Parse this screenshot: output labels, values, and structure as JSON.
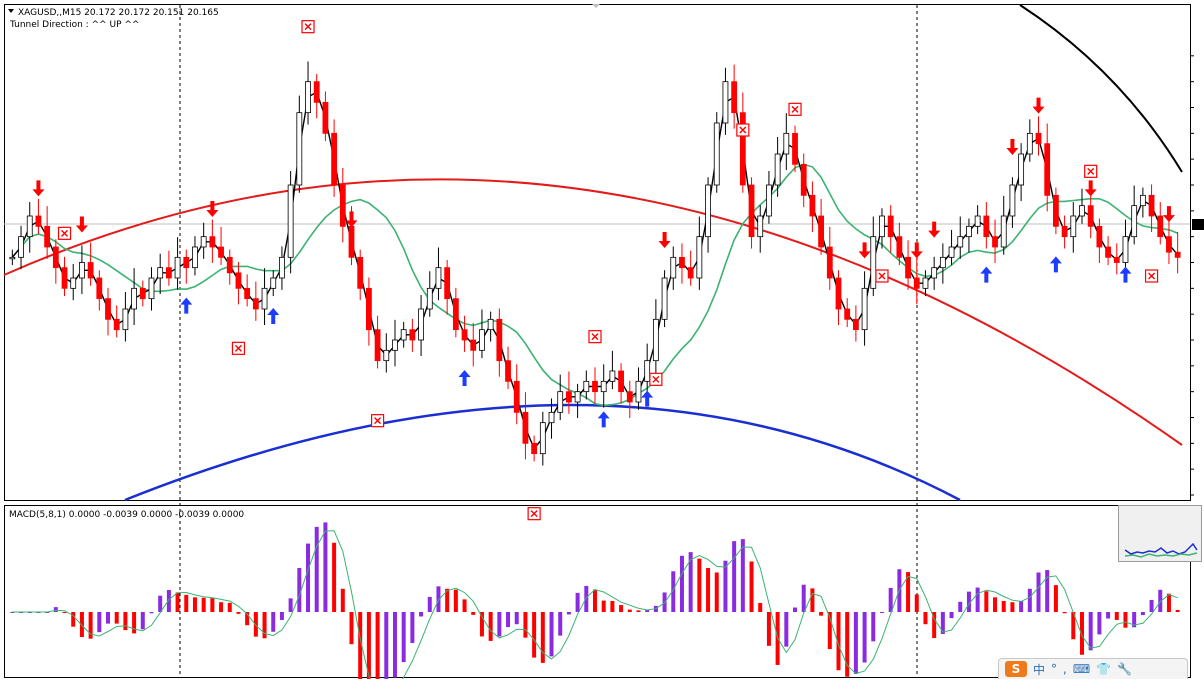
{
  "header": {
    "symbol_line": "XAGUSD,,M15  20.172 20.172 20.151 20.165",
    "tunnel_line": "Tunnel Direction : ^^ UP ^^"
  },
  "macd": {
    "label": "MACD(5,8,1) 0.0000 -0.0039 0.0000 -0.0039 0.0000"
  },
  "colors": {
    "bull": "#ffffff",
    "bear": "#ff0000",
    "ma_fast": "#000000",
    "ma_slow": "#3cb371",
    "arc_red": "#e31b1b",
    "arc_blue": "#1a2fd1",
    "arc_black": "#000000",
    "arrow_up": "#1e3cff",
    "arrow_down": "#ff0000",
    "hist_purple": "#8a2be2",
    "hist_red": "#ff0000"
  },
  "chart_data": {
    "type": "candlestick",
    "series": [
      {
        "name": "XAGUSD,M15",
        "values": [
          20.172,
          20.172,
          20.151,
          20.165
        ]
      }
    ],
    "price_sequence": [
      20.16,
      20.2,
      20.24,
      20.22,
      20.18,
      20.14,
      20.1,
      20.12,
      20.15,
      20.12,
      20.08,
      20.04,
      20.02,
      20.06,
      20.1,
      20.08,
      20.12,
      20.14,
      20.12,
      20.16,
      20.14,
      20.18,
      20.2,
      20.18,
      20.16,
      20.13,
      20.1,
      20.08,
      20.06,
      20.1,
      20.12,
      20.16,
      20.3,
      20.44,
      20.5,
      20.46,
      20.4,
      20.3,
      20.22,
      20.16,
      20.1,
      20.02,
      19.96,
      19.98,
      20.0,
      20.02,
      20.0,
      20.06,
      20.1,
      20.14,
      20.08,
      20.02,
      20.0,
      19.98,
      20.02,
      20.04,
      19.96,
      19.92,
      19.86,
      19.8,
      19.78,
      19.84,
      19.86,
      19.9,
      19.88,
      19.9,
      19.92,
      19.9,
      19.92,
      19.94,
      19.9,
      19.88,
      19.92,
      19.96,
      20.04,
      20.12,
      20.16,
      20.14,
      20.12,
      20.2,
      20.3,
      20.42,
      20.5,
      20.44,
      20.3,
      20.2,
      20.24,
      20.3,
      20.36,
      20.4,
      20.34,
      20.28,
      20.24,
      20.18,
      20.12,
      20.06,
      20.04,
      20.02,
      20.1,
      20.2,
      20.24,
      20.2,
      20.16,
      20.12,
      20.1,
      20.12,
      20.14,
      20.16,
      20.18,
      20.2,
      20.22,
      20.24,
      20.2,
      20.18,
      20.24,
      20.3,
      20.36,
      20.4,
      20.38,
      20.28,
      20.22,
      20.2,
      20.24,
      20.26,
      20.22,
      20.18,
      20.16,
      20.15,
      20.2,
      20.26,
      20.28,
      20.24,
      20.2,
      20.17,
      20.16
    ]
  },
  "markers": {
    "up_arrows": 9,
    "down_arrows": 12,
    "box_markers": 13
  },
  "widget": {
    "logo": "S",
    "items": [
      "中",
      "°",
      ",",
      "⌨",
      "👕",
      "🔧"
    ]
  }
}
